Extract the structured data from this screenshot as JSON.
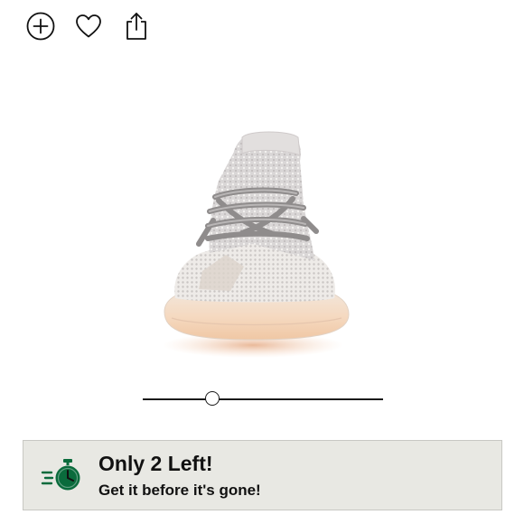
{
  "toolbar": {
    "icons": [
      "add-circle-icon",
      "heart-icon",
      "share-icon"
    ]
  },
  "product": {
    "image": "sneaker-front-view"
  },
  "slider": {
    "value_fraction": 0.29
  },
  "banner": {
    "title": "Only 2 Left!",
    "subtitle": "Get it before it's gone!",
    "icon": "stopwatch-icon",
    "accent_color": "#0a6b3c",
    "background_color": "#e8e8e3"
  }
}
